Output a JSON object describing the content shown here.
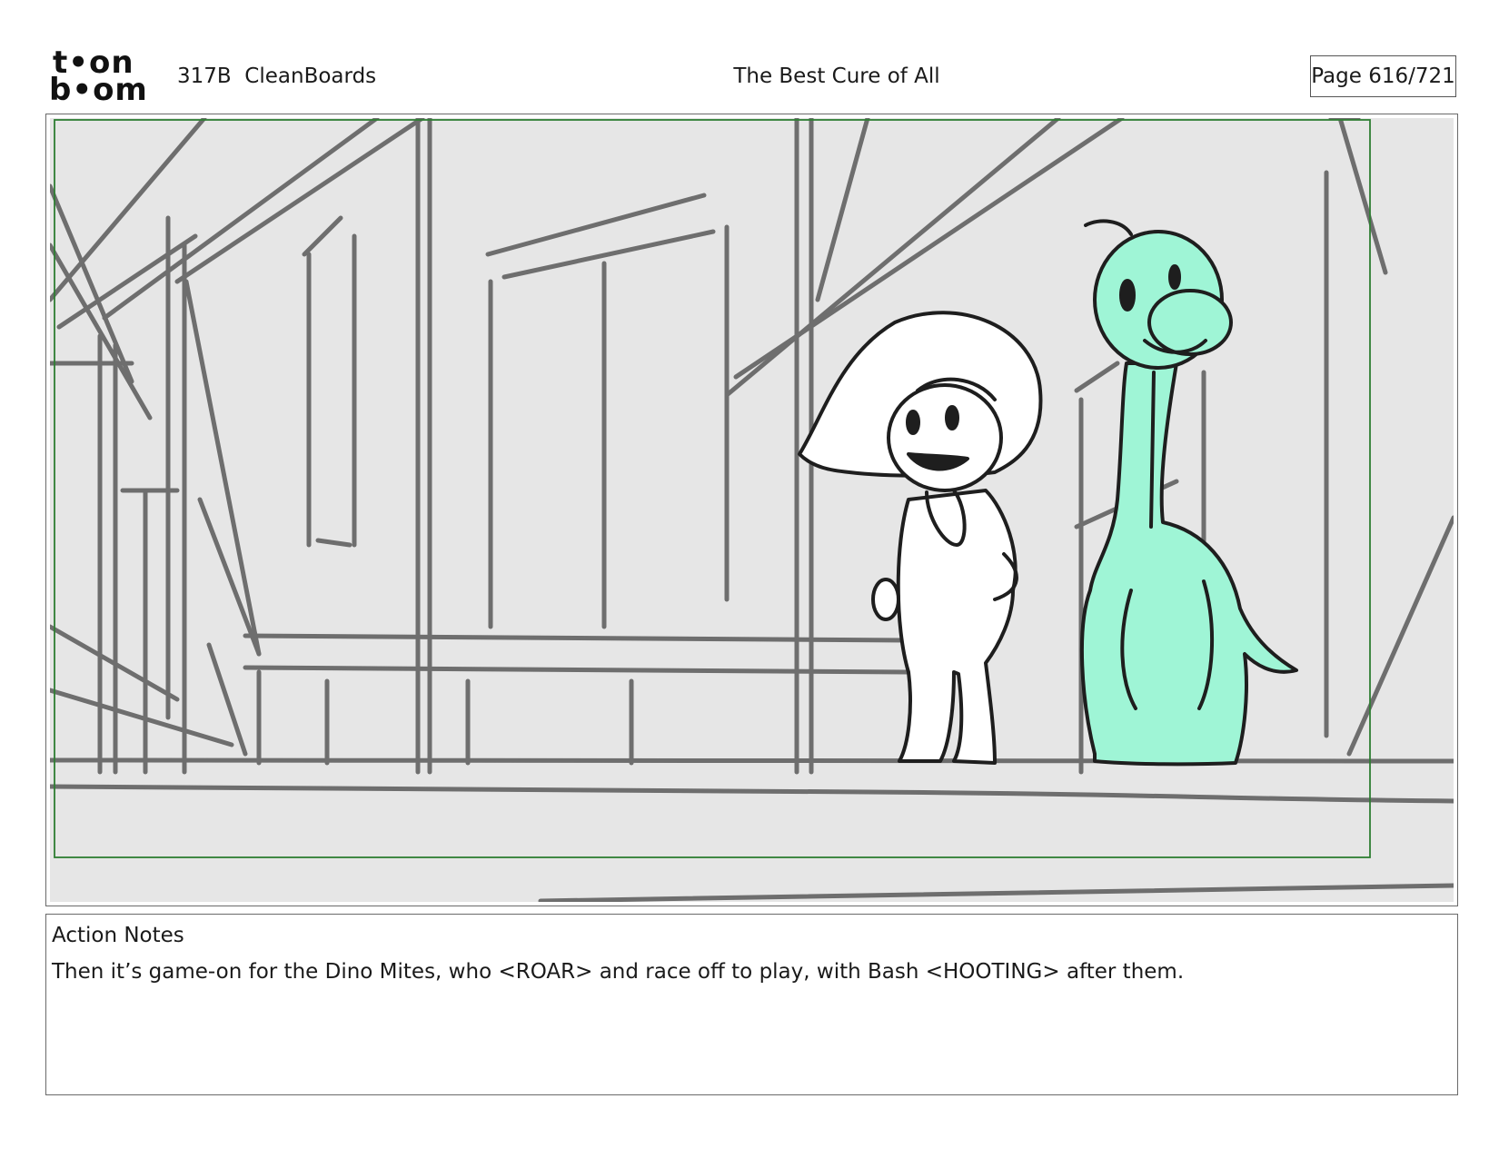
{
  "header": {
    "logo_line1": "t•on",
    "logo_line2": "b•om",
    "production": "317B  CleanBoards",
    "episode_title": "The Best Cure of All",
    "page": "Page 616/721"
  },
  "notes": {
    "title": "Action Notes",
    "text": "Then it’s game-on for the Dino Mites, who <ROAR> and race off to play, with Bash <HOOTING> after them."
  },
  "colors": {
    "background_sketch": "#e6e6e6",
    "sketch_lines": "#6e6e6e",
    "safe_frame": "#2e7d32",
    "dino_fill": "#9ff5d6",
    "character_lines": "#1e1e1e"
  }
}
